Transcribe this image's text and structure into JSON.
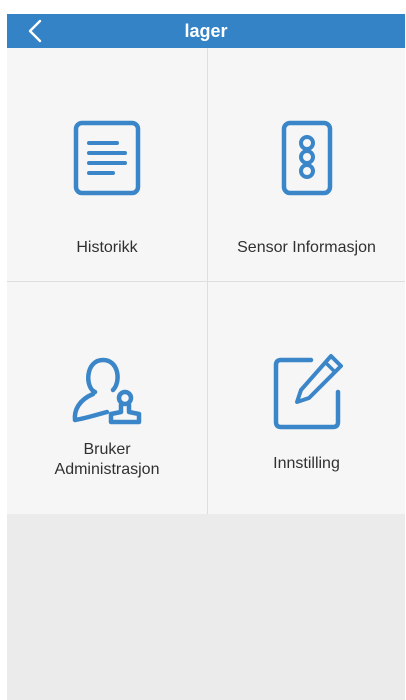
{
  "header": {
    "title": "lager",
    "back_icon": "chevron-left-icon"
  },
  "menu": {
    "items": [
      {
        "label": "Historikk",
        "icon": "document-lines-icon"
      },
      {
        "label": "Sensor Informasjon",
        "icon": "sensor-dots-icon"
      },
      {
        "label": "Bruker\nAdministrasjon",
        "icon": "user-stamp-icon"
      },
      {
        "label": "Innstilling",
        "icon": "edit-pencil-icon"
      }
    ]
  },
  "colors": {
    "header_bg": "#3483c6",
    "icon_blue": "#3a86c8",
    "tile_bg": "#f6f6f7",
    "page_bg": "#ebebeb"
  }
}
